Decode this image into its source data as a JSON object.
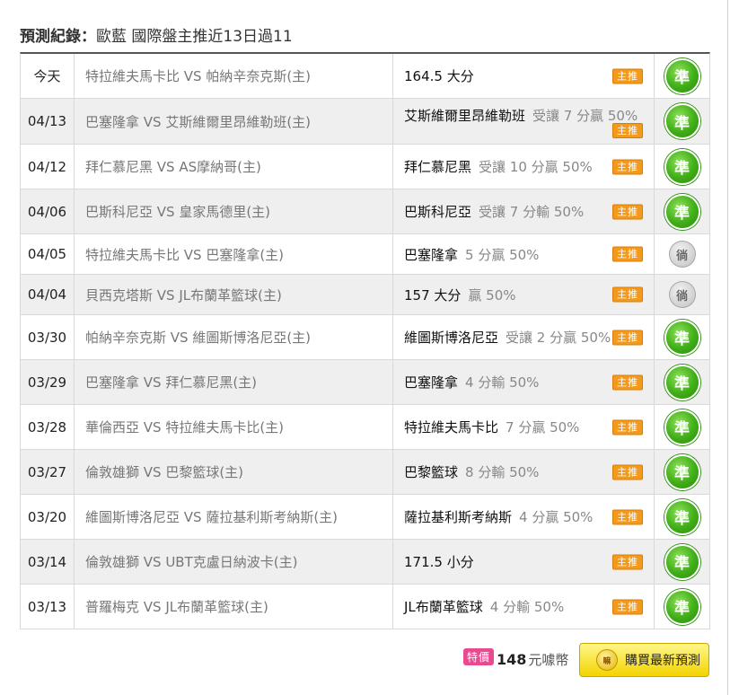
{
  "title": {
    "lead": "預測紀錄：",
    "sub": "歐藍 國際盤主推近13日過11"
  },
  "tag_label": "主推",
  "rows": [
    {
      "date": "今天",
      "match": "特拉維夫馬卡比 VS 帕納辛奈克斯(主)",
      "pick_team": "164.5 大分",
      "pick_note": "",
      "result": "",
      "result_type": "win"
    },
    {
      "date": "04/13",
      "match": "巴塞隆拿 VS 艾斯維爾里昂維勒班(主)",
      "pick_team": "艾斯維爾里昂維勒班",
      "pick_note": "受讓 7 分贏 50%",
      "result": "準",
      "result_type": "win"
    },
    {
      "date": "04/12",
      "match": "拜仁慕尼黑 VS AS摩納哥(主)",
      "pick_team": "拜仁慕尼黑",
      "pick_note": "受讓 10 分贏 50%",
      "result": "準",
      "result_type": "win"
    },
    {
      "date": "04/06",
      "match": "巴斯科尼亞 VS 皇家馬德里(主)",
      "pick_team": "巴斯科尼亞",
      "pick_note": "受讓 7 分輸 50%",
      "result": "準",
      "result_type": "win"
    },
    {
      "date": "04/05",
      "match": "特拉維夫馬卡比 VS 巴塞隆拿(主)",
      "pick_team": "巴塞隆拿",
      "pick_note": "5 分贏 50%",
      "result": "徜",
      "result_type": "void"
    },
    {
      "date": "04/04",
      "match": "貝西克塔斯 VS JL布蘭革籃球(主)",
      "pick_team": "157 大分",
      "pick_note": "贏 50%",
      "result": "徜",
      "result_type": "void"
    },
    {
      "date": "03/30",
      "match": "帕納辛奈克斯 VS 維圖斯博洛尼亞(主)",
      "pick_team": "維圖斯博洛尼亞",
      "pick_note": "受讓 2 分贏 50%",
      "result": "準",
      "result_type": "win"
    },
    {
      "date": "03/29",
      "match": "巴塞隆拿 VS 拜仁慕尼黑(主)",
      "pick_team": "巴塞隆拿",
      "pick_note": "4 分輸 50%",
      "result": "準",
      "result_type": "win"
    },
    {
      "date": "03/28",
      "match": "華倫西亞 VS 特拉維夫馬卡比(主)",
      "pick_team": "特拉維夫馬卡比",
      "pick_note": "7 分贏 50%",
      "result": "準",
      "result_type": "win"
    },
    {
      "date": "03/27",
      "match": "倫敦雄獅 VS 巴黎籃球(主)",
      "pick_team": "巴黎籃球",
      "pick_note": "8 分輸 50%",
      "result": "準",
      "result_type": "win"
    },
    {
      "date": "03/20",
      "match": "維圖斯博洛尼亞 VS 薩拉基利斯考納斯(主)",
      "pick_team": "薩拉基利斯考納斯",
      "pick_note": "4 分贏 50%",
      "result": "準",
      "result_type": "win"
    },
    {
      "date": "03/14",
      "match": "倫敦雄獅 VS UBT克盧日納波卡(主)",
      "pick_team": "171.5 小分",
      "pick_note": "",
      "result": "準",
      "result_type": "win"
    },
    {
      "date": "03/13",
      "match": "普羅梅克 VS JL布蘭革籃球(主)",
      "pick_team": "JL布蘭革籃球",
      "pick_note": "4 分輸 50%",
      "result": "準",
      "result_type": "win"
    }
  ],
  "footer": {
    "sale_label": "特價",
    "price": "148",
    "price_unit": "元噱幣",
    "coin_label": "嘛",
    "buy_label": "購買最新預測"
  },
  "colors": {
    "tag": "#f39a1c",
    "win_badge": "#3fae17",
    "void_badge": "#cfcfcf",
    "sale_tag": "#e9498f",
    "buy_button": "#f3d400"
  }
}
